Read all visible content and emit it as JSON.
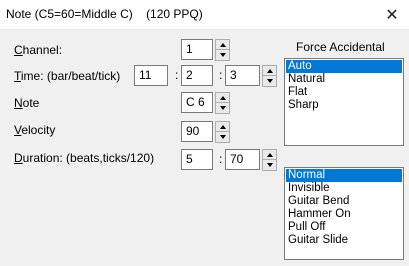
{
  "window": {
    "title": "Note (C5=60=Middle C)    (120 PPQ)",
    "close_glyph": "✕"
  },
  "channel": {
    "label_u": "C",
    "label_rest": "hannel:",
    "value": "1"
  },
  "time": {
    "label_u": "T",
    "label_rest": "ime: (bar/beat/tick)",
    "bar": "11",
    "beat": "2",
    "tick": "3"
  },
  "note": {
    "label_u": "N",
    "label_rest": "ote",
    "value": "C 6"
  },
  "velocity": {
    "label_u": "V",
    "label_rest": "elocity",
    "value": "90"
  },
  "duration": {
    "label_u": "D",
    "label_rest": "uration: (beats,ticks/120)",
    "beats": "5",
    "ticks": "70"
  },
  "separator": ":",
  "force_accidental": {
    "title": "Force Accidental",
    "items": [
      "Auto",
      "Natural",
      "Flat",
      "Sharp"
    ],
    "selected": "Auto"
  },
  "note_style": {
    "items": [
      "Normal",
      "Invisible",
      "Guitar Bend",
      "Hammer On",
      "Pull Off",
      "Guitar Slide"
    ],
    "selected": "Normal"
  }
}
